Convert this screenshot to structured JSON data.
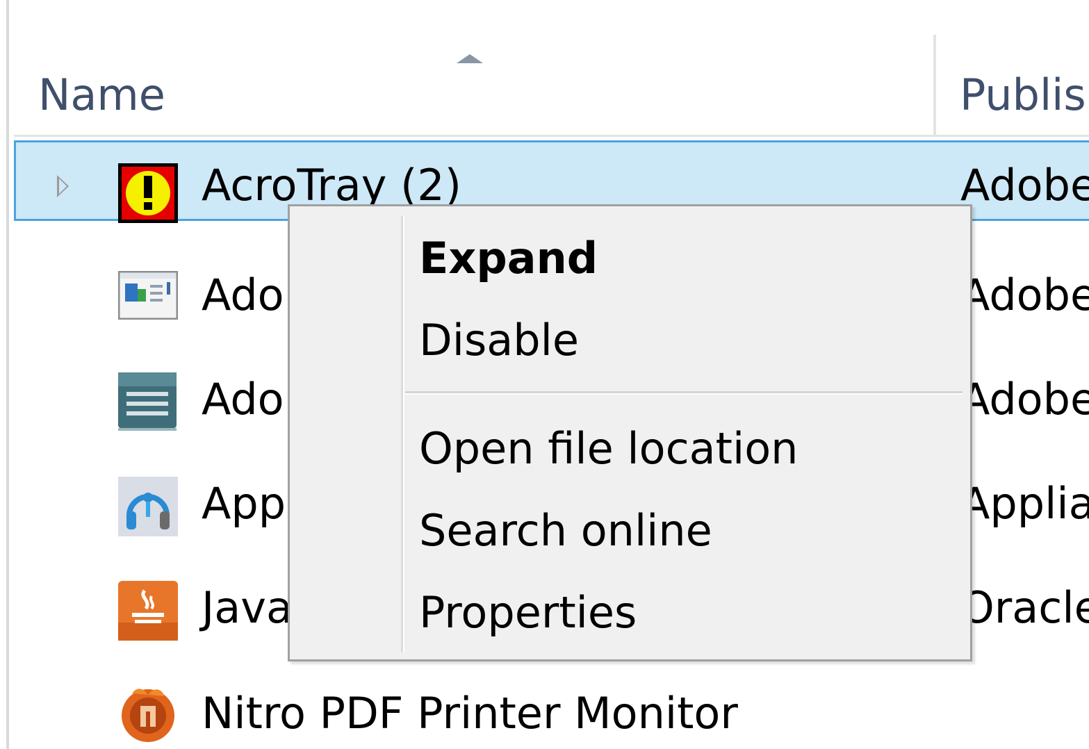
{
  "header": {
    "col_name": "Name",
    "col_publisher": "Publis"
  },
  "rows": [
    {
      "name": "AcroTray (2)",
      "publisher": "Adobe",
      "icon": "acrotray-warning-icon",
      "selected": true,
      "expandable": true
    },
    {
      "name": "Adol",
      "publisher": "Adobe",
      "icon": "window-app-icon",
      "selected": false,
      "expandable": false
    },
    {
      "name": "Adol",
      "publisher": "Adobe",
      "icon": "service-list-icon",
      "selected": false,
      "expandable": false
    },
    {
      "name": "Appl",
      "publisher": "Applia",
      "icon": "headset-app-icon",
      "selected": false,
      "expandable": false
    },
    {
      "name": "Java",
      "publisher": "Oracle",
      "icon": "java-icon",
      "selected": false,
      "expandable": false
    },
    {
      "name": "Nitro PDF Printer Monitor",
      "publisher": "",
      "icon": "nitro-pdf-icon",
      "selected": false,
      "expandable": false
    }
  ],
  "context_menu": {
    "items": [
      {
        "label": "Expand",
        "bold": true
      },
      {
        "label": "Disable",
        "bold": false
      },
      {
        "label": "Open file location",
        "bold": false
      },
      {
        "label": "Search online",
        "bold": false
      },
      {
        "label": "Properties",
        "bold": false
      }
    ]
  },
  "colors": {
    "selection_bg": "#cde8f6",
    "selection_border": "#4aa3df",
    "header_text": "#3f4f6b",
    "menu_bg": "#f0f0f0"
  }
}
